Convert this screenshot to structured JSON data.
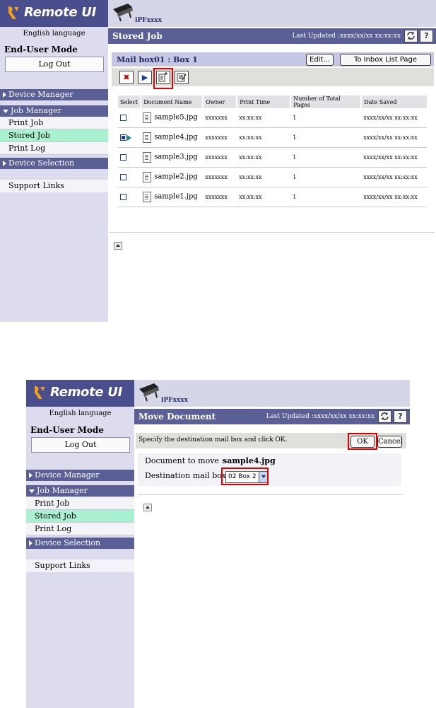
{
  "common": {
    "logo_text": "Remote UI",
    "language": "English language",
    "mode": "End-User Mode",
    "logout": "Log Out",
    "printer_name": "iPFxxxx",
    "last_updated": "Last Updated :xxxx/xx/xx xx:xx:xx",
    "refresh_icon": "refresh-icon",
    "help_label": "?",
    "menu": {
      "device_manager": "Device Manager",
      "job_manager": "Job Manager",
      "print_job": "Print Job",
      "stored_job": "Stored Job",
      "print_log": "Print Log",
      "device_selection": "Device Selection",
      "support_links": "Support Links"
    },
    "colors": {
      "sidebar_header": "#5a5f96",
      "active_item": "#a9f1d1",
      "highlight": "#e00000"
    }
  },
  "screen1": {
    "title": "Stored Job",
    "mailbox_title": "Mail box01 : Box 1",
    "edit_button": "Edit...",
    "inbox_button": "To Inbox List Page",
    "toolbar_icons": [
      "delete-icon",
      "print-icon",
      "move-icon",
      "edit-details-icon"
    ],
    "columns": [
      "Select",
      "Document Name",
      "Owner",
      "Print Time",
      "Number of Total Pages",
      "Date Saved"
    ],
    "rows": [
      {
        "name": "sample5.jpg",
        "owner": "xxxxxxx",
        "time": "xx:xx:xx",
        "pages": "1",
        "date": "xxxx/xx/xx xx:xx:xx",
        "selected": false
      },
      {
        "name": "sample4.jpg",
        "owner": "xxxxxxx",
        "time": "xx:xx:xx",
        "pages": "1",
        "date": "xxxx/xx/xx xx:xx:xx",
        "selected": true
      },
      {
        "name": "sample3.jpg",
        "owner": "xxxxxxx",
        "time": "xx:xx:xx",
        "pages": "1",
        "date": "xxxx/xx/xx xx:xx:xx",
        "selected": false
      },
      {
        "name": "sample2.jpg",
        "owner": "xxxxxxx",
        "time": "xx:xx:xx",
        "pages": "1",
        "date": "xxxx/xx/xx xx:xx:xx",
        "selected": false
      },
      {
        "name": "sample1.jpg",
        "owner": "xxxxxxx",
        "time": "xx:xx:xx",
        "pages": "1",
        "date": "xxxx/xx/xx xx:xx:xx",
        "selected": false
      }
    ]
  },
  "screen2": {
    "title": "Move Document",
    "instruction": "Specify the destination mail box and click OK.",
    "ok": "OK",
    "cancel": "Cancel",
    "doc_label": "Document to move :",
    "doc_value": "sample4.jpg",
    "dest_label": "Destination mail box :",
    "dest_value": "02 Box 2"
  }
}
